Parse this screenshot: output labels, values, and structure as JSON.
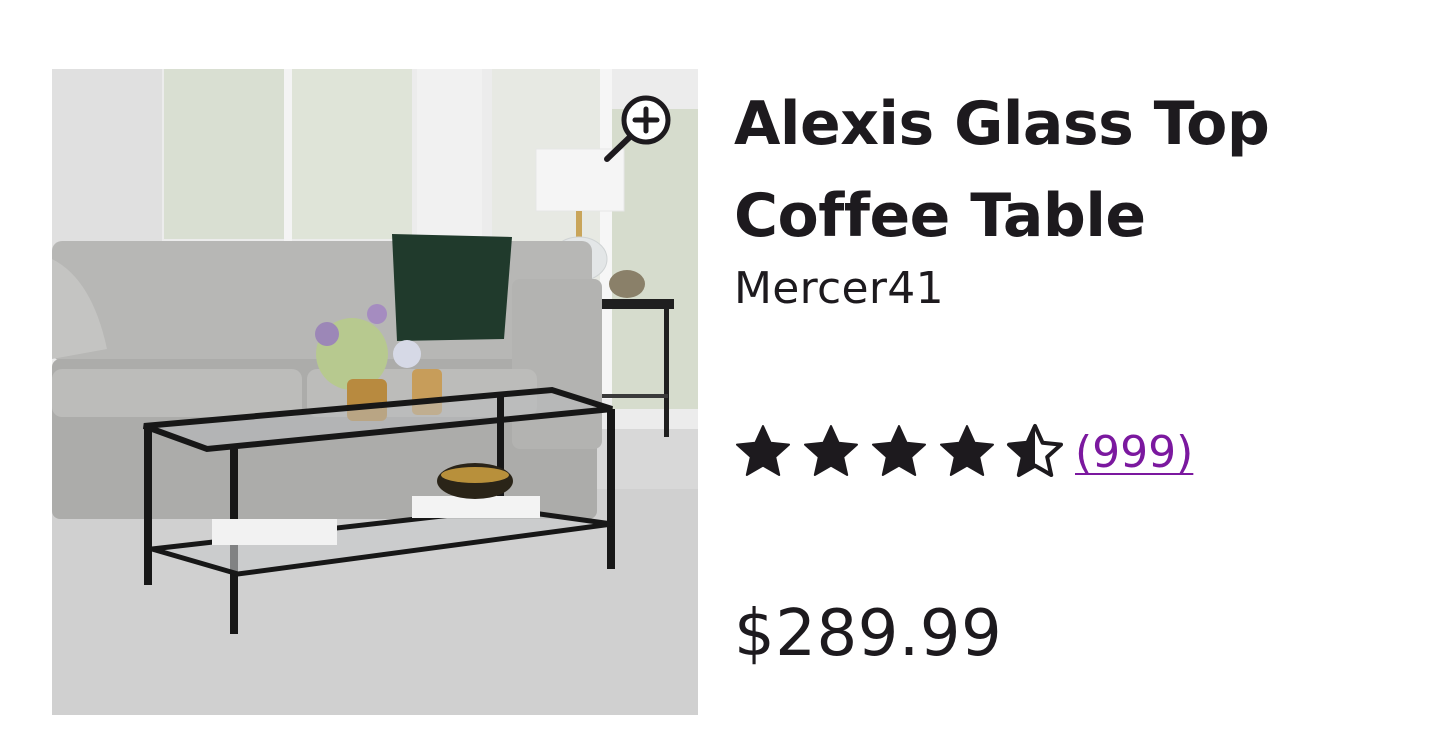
{
  "product": {
    "title_line1": "Alexis Glass Top",
    "title_line2": "Coffee Table",
    "brand": "Mercer41",
    "rating": 4.5,
    "rating_max": 5,
    "review_count": "(999)",
    "price": "$289.99"
  },
  "image": {
    "zoom_icon": "zoom-in-icon",
    "subject": "coffee-table-photo"
  },
  "colors": {
    "text": "#1d1a1e",
    "link": "#7b189f",
    "background": "#ffffff"
  }
}
